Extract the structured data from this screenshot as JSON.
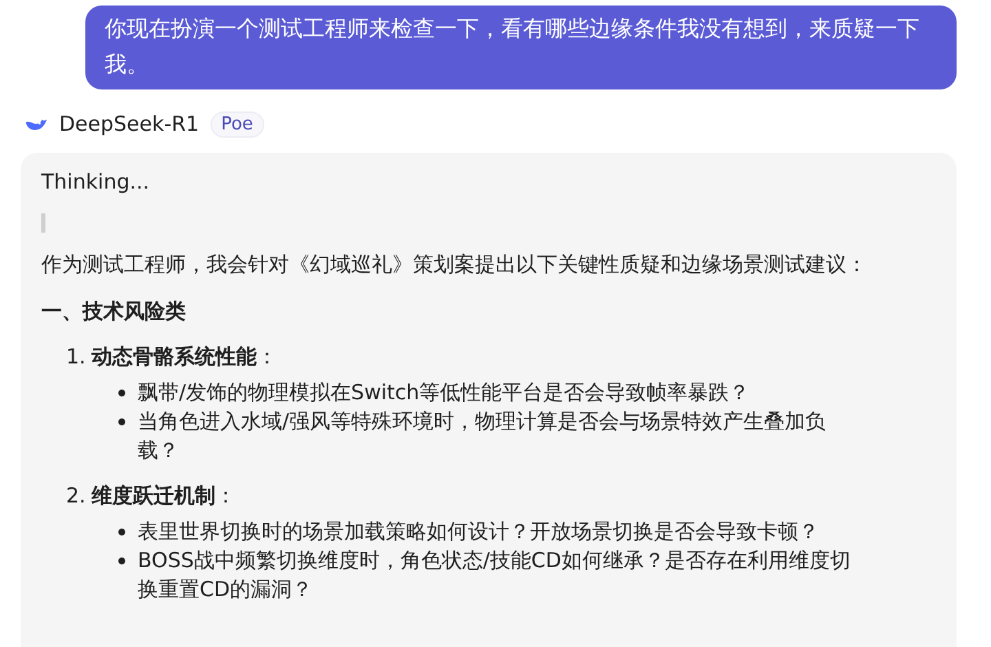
{
  "user_message": "你现在扮演一个测试工程师来检查一下，看有哪些边缘条件我没有想到，来质疑一下我。",
  "bot": {
    "name": "DeepSeek-R1",
    "badge": "Poe"
  },
  "response": {
    "thinking": "Thinking...",
    "intro": "作为测试工程师，我会针对《幻域巡礼》策划案提出以下关键性质疑和边缘场景测试建议：",
    "sections": [
      {
        "heading": "一、技术风险类",
        "items": [
          {
            "number": "1.",
            "title": "**动态骨骼系统性能**：",
            "bullets": [
              "飘带/发饰的物理模拟在Switch等低性能平台是否会导致帧率暴跌？",
              "当角色进入水域/强风等特殊环境时，物理计算是否会与场景特效产生叠加负载？"
            ]
          },
          {
            "number": "2.",
            "title": "**维度跃迁机制**：",
            "bullets": [
              "表里世界切换时的场景加载策略如何设计？开放场景切换是否会导致卡顿？",
              "BOSS战中频繁切换维度时，角色状态/技能CD如何继承？是否存在利用维度切换重置CD的漏洞？"
            ]
          }
        ]
      }
    ]
  }
}
